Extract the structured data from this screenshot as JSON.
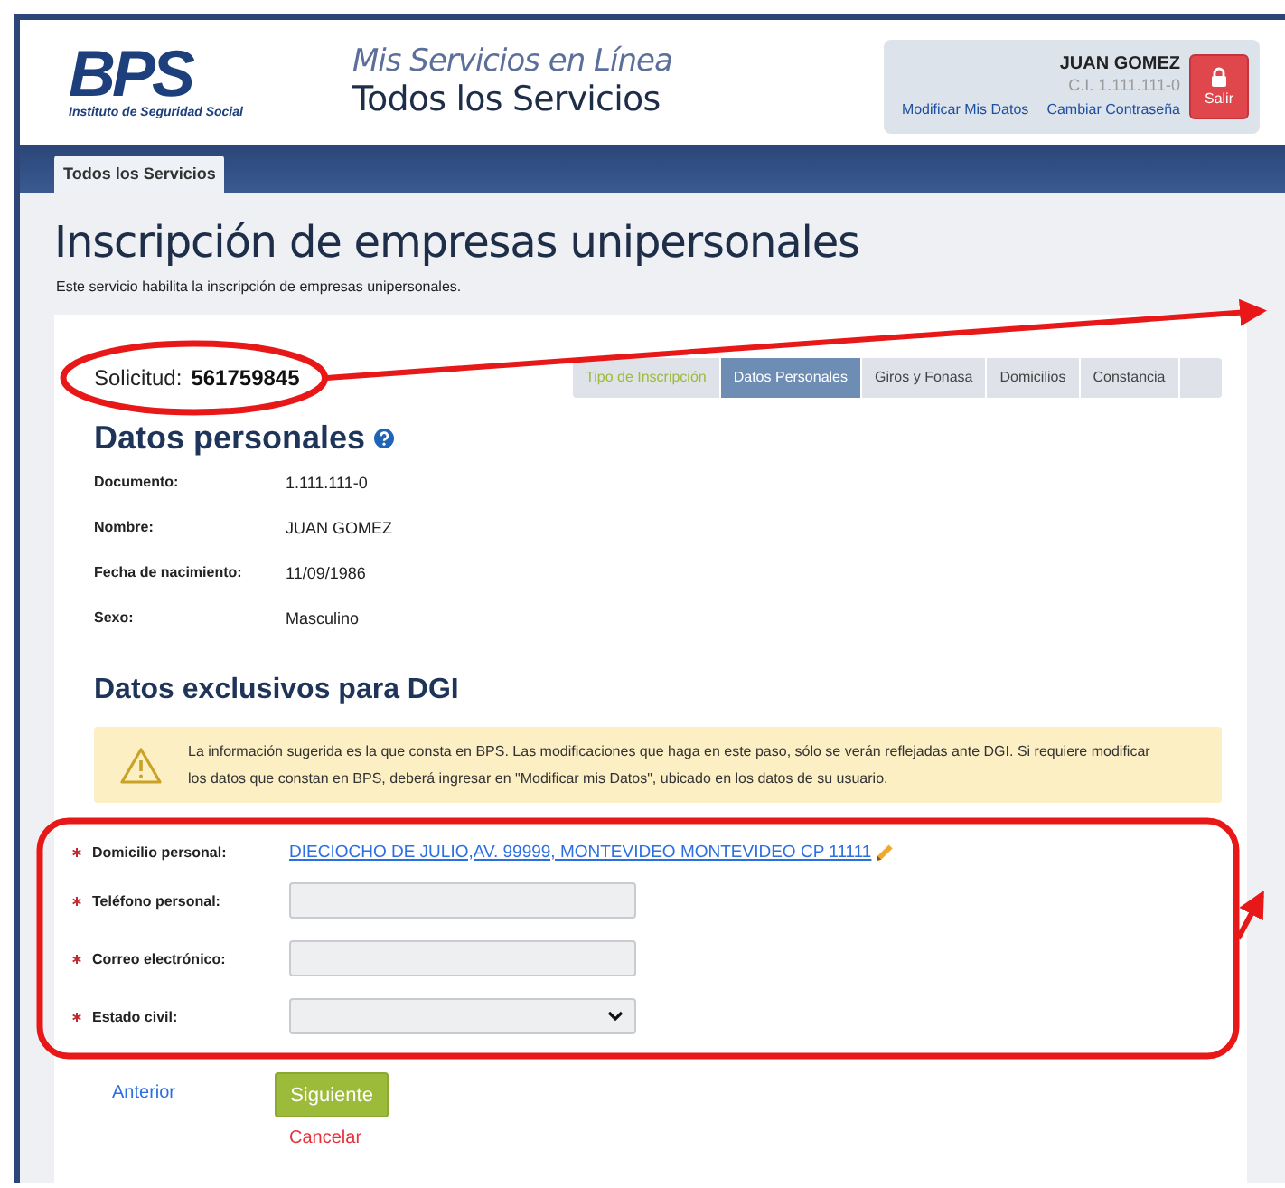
{
  "header": {
    "logo": {
      "mark": "BPS",
      "subtitle": "Instituto de Seguridad Social"
    },
    "service_line": "Mis Servicios en Línea",
    "service_title": "Todos los Servicios",
    "user": {
      "name": "JUAN GOMEZ",
      "id": "C.I. 1.111.111-0",
      "links": [
        "Modificar Mis Datos",
        "Cambiar Contraseña"
      ],
      "logout": "Salir"
    }
  },
  "tabs": [
    {
      "label": "Todos los Servicios",
      "selected": true
    }
  ],
  "page": {
    "title": "Inscripción de empresas unipersonales",
    "subtitle": "Este servicio habilita la inscripción de empresas unipersonales."
  },
  "request": {
    "label": "Solicitud:",
    "number": "561759845"
  },
  "steps": [
    {
      "label": "Tipo de Inscripción",
      "completed": true,
      "selected": false
    },
    {
      "label": "Datos Personales",
      "completed": false,
      "selected": true
    },
    {
      "label": "Giros y Fonasa",
      "completed": false,
      "selected": false
    },
    {
      "label": "Domicilios",
      "completed": false,
      "selected": false
    },
    {
      "label": "Constancia",
      "completed": false,
      "selected": false
    }
  ],
  "personal": {
    "title": "Datos personales",
    "fields": [
      {
        "label": "Documento:",
        "value": "1.111.111-0"
      },
      {
        "label": "Nombre:",
        "value": "JUAN GOMEZ"
      },
      {
        "label": "Fecha de nacimiento:",
        "value": "11/09/1986"
      },
      {
        "label": "Sexo:",
        "value": "Masculino"
      }
    ]
  },
  "dgi": {
    "title": "Datos exclusivos para DGI",
    "alert": "La información sugerida es la que consta en BPS. Las modificaciones que haga en este paso, sólo se verán reflejadas ante DGI. Si requiere modificar los datos que constan en BPS, deberá ingresar en \"Modificar mis Datos\", ubicado en los datos de su usuario.",
    "fields": [
      {
        "label": "Domicilio personal:",
        "kind": "link",
        "value": "DIECIOCHO DE JULIO,AV. 99999, MONTEVIDEO MONTEVIDEO CP 11111",
        "required": true
      },
      {
        "label": "Teléfono personal:",
        "kind": "text",
        "required": true
      },
      {
        "label": "Correo electrónico:",
        "kind": "text",
        "required": true
      },
      {
        "label": "Estado civil:",
        "kind": "select",
        "required": true
      }
    ]
  },
  "actions": {
    "back": "Anterior",
    "next": "Siguiente",
    "cancel": "Cancelar"
  },
  "annotations": [
    {
      "kind": "ellipse"
    },
    {
      "kind": "box"
    }
  ]
}
